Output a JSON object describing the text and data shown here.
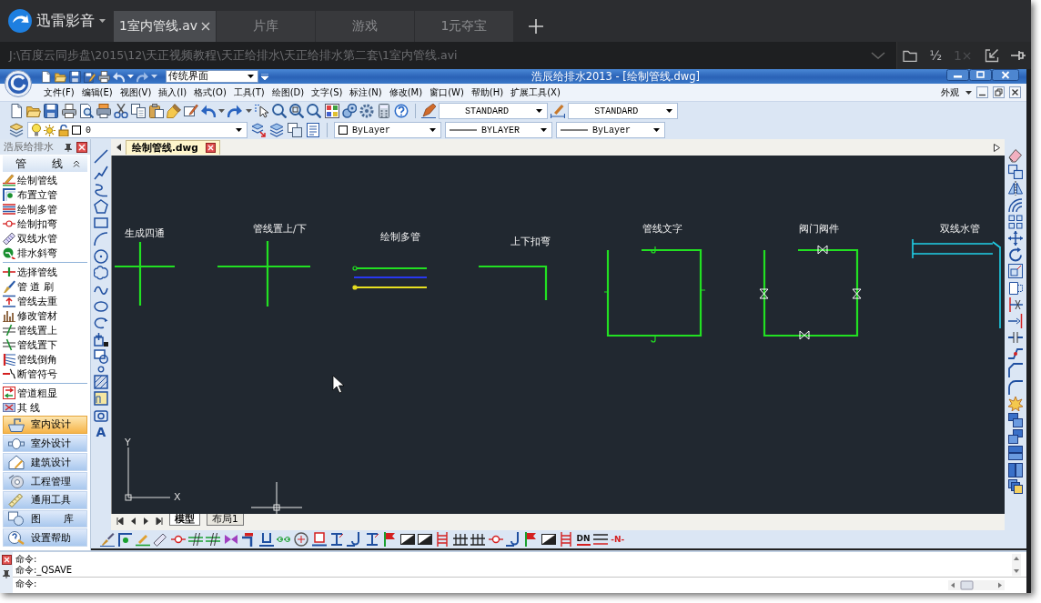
{
  "player": {
    "app_name": "迅雷影音",
    "tabs": [
      {
        "label": "1室内管线.av",
        "selected": true
      },
      {
        "label": "片库",
        "selected": false
      },
      {
        "label": "游戏",
        "selected": false
      },
      {
        "label": "1元夺宝",
        "selected": false
      }
    ],
    "file_path": "J:\\百度云同步盘\\2015\\12\\天正视频教程\\天正给排水\\天正给排水第二套\\1室内管线.avi",
    "size_buttons": [
      {
        "label": "½",
        "disabled": false
      },
      {
        "label": "1×",
        "disabled": true
      }
    ]
  },
  "cad": {
    "title": "浩辰给排水2013 - [绘制管线.dwg]",
    "workspace": "传统界面",
    "menu": [
      "文件(F)",
      "编辑(E)",
      "视图(V)",
      "插入(I)",
      "格式(O)",
      "工具(T)",
      "绘图(D)",
      "文字(S)",
      "标注(N)",
      "修改(M)",
      "窗口(W)",
      "帮助(H)",
      "扩展工具(X)"
    ],
    "appearance": "外观",
    "text_style": "STANDARD",
    "dim_style": "STANDARD",
    "layer": "0",
    "property_dropdowns": [
      "ByLayer",
      "BYLAYER",
      "ByLayer"
    ],
    "panel": {
      "title": "浩辰给排水",
      "section": "管 线",
      "tool_groups": [
        [
          "绘制管线",
          "布置立管",
          "绘制多管",
          "绘制扣弯",
          "双线水管",
          "排水斜弯"
        ],
        [
          "选择管线",
          "管 道 刷",
          "管线去重",
          "修改管材",
          "管线置上",
          "管线置下",
          "管线倒角",
          "断管符号"
        ],
        [
          "管道粗显",
          "其 线"
        ]
      ],
      "categories": [
        {
          "label": "室内设计",
          "selected": true
        },
        {
          "label": "室外设计",
          "selected": false
        },
        {
          "label": "建筑设计",
          "selected": false
        },
        {
          "label": "工程管理",
          "selected": false
        },
        {
          "label": "通用工具",
          "selected": false
        },
        {
          "label": "图 库",
          "selected": false
        },
        {
          "label": "设置帮助",
          "selected": false
        }
      ]
    },
    "text_tool": "A",
    "document_tab": "绘制管线.dwg",
    "drawing_labels": [
      "生成四通",
      "管线置上/下",
      "绘制多管",
      "上下扣弯",
      "管线文字",
      "阀门阀件",
      "双线水管"
    ],
    "axis_labels": [
      "Y",
      "X"
    ],
    "layout_tabs": [
      {
        "label": "模型",
        "selected": true
      },
      {
        "label": "布局1",
        "selected": false
      }
    ],
    "toolbar_text_buttons": [
      "DN",
      "-N-"
    ],
    "command_history": [
      "命令:",
      "命令:_QSAVE"
    ],
    "command_prompt": "命令:"
  }
}
